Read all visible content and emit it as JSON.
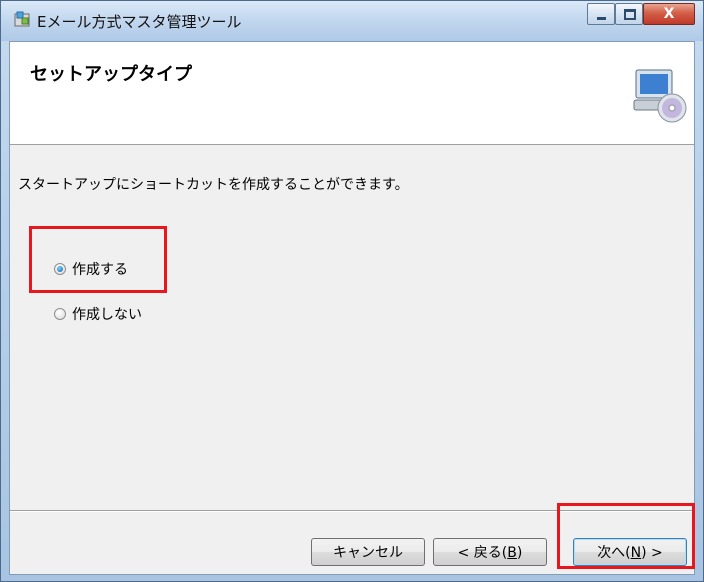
{
  "window": {
    "title": "Eメール方式マスタ管理ツール",
    "controls": {
      "minimize": "minimize",
      "maximize": "maximize",
      "close": "X"
    }
  },
  "header": {
    "title": "セットアップタイプ",
    "icon": "computer-cd-icon"
  },
  "body": {
    "description": "スタートアップにショートカットを作成することができます。",
    "options": [
      {
        "label": "作成する",
        "checked": true
      },
      {
        "label": "作成しない",
        "checked": false
      }
    ]
  },
  "buttons": {
    "cancel": "キャンセル",
    "back_prefix": "< 戻る(",
    "back_key": "B",
    "back_suffix": ")",
    "next_prefix": "次へ(",
    "next_key": "N",
    "next_suffix": ") >"
  },
  "colors": {
    "highlight": "#e8161d",
    "titlebar": "#c3d8ef"
  }
}
